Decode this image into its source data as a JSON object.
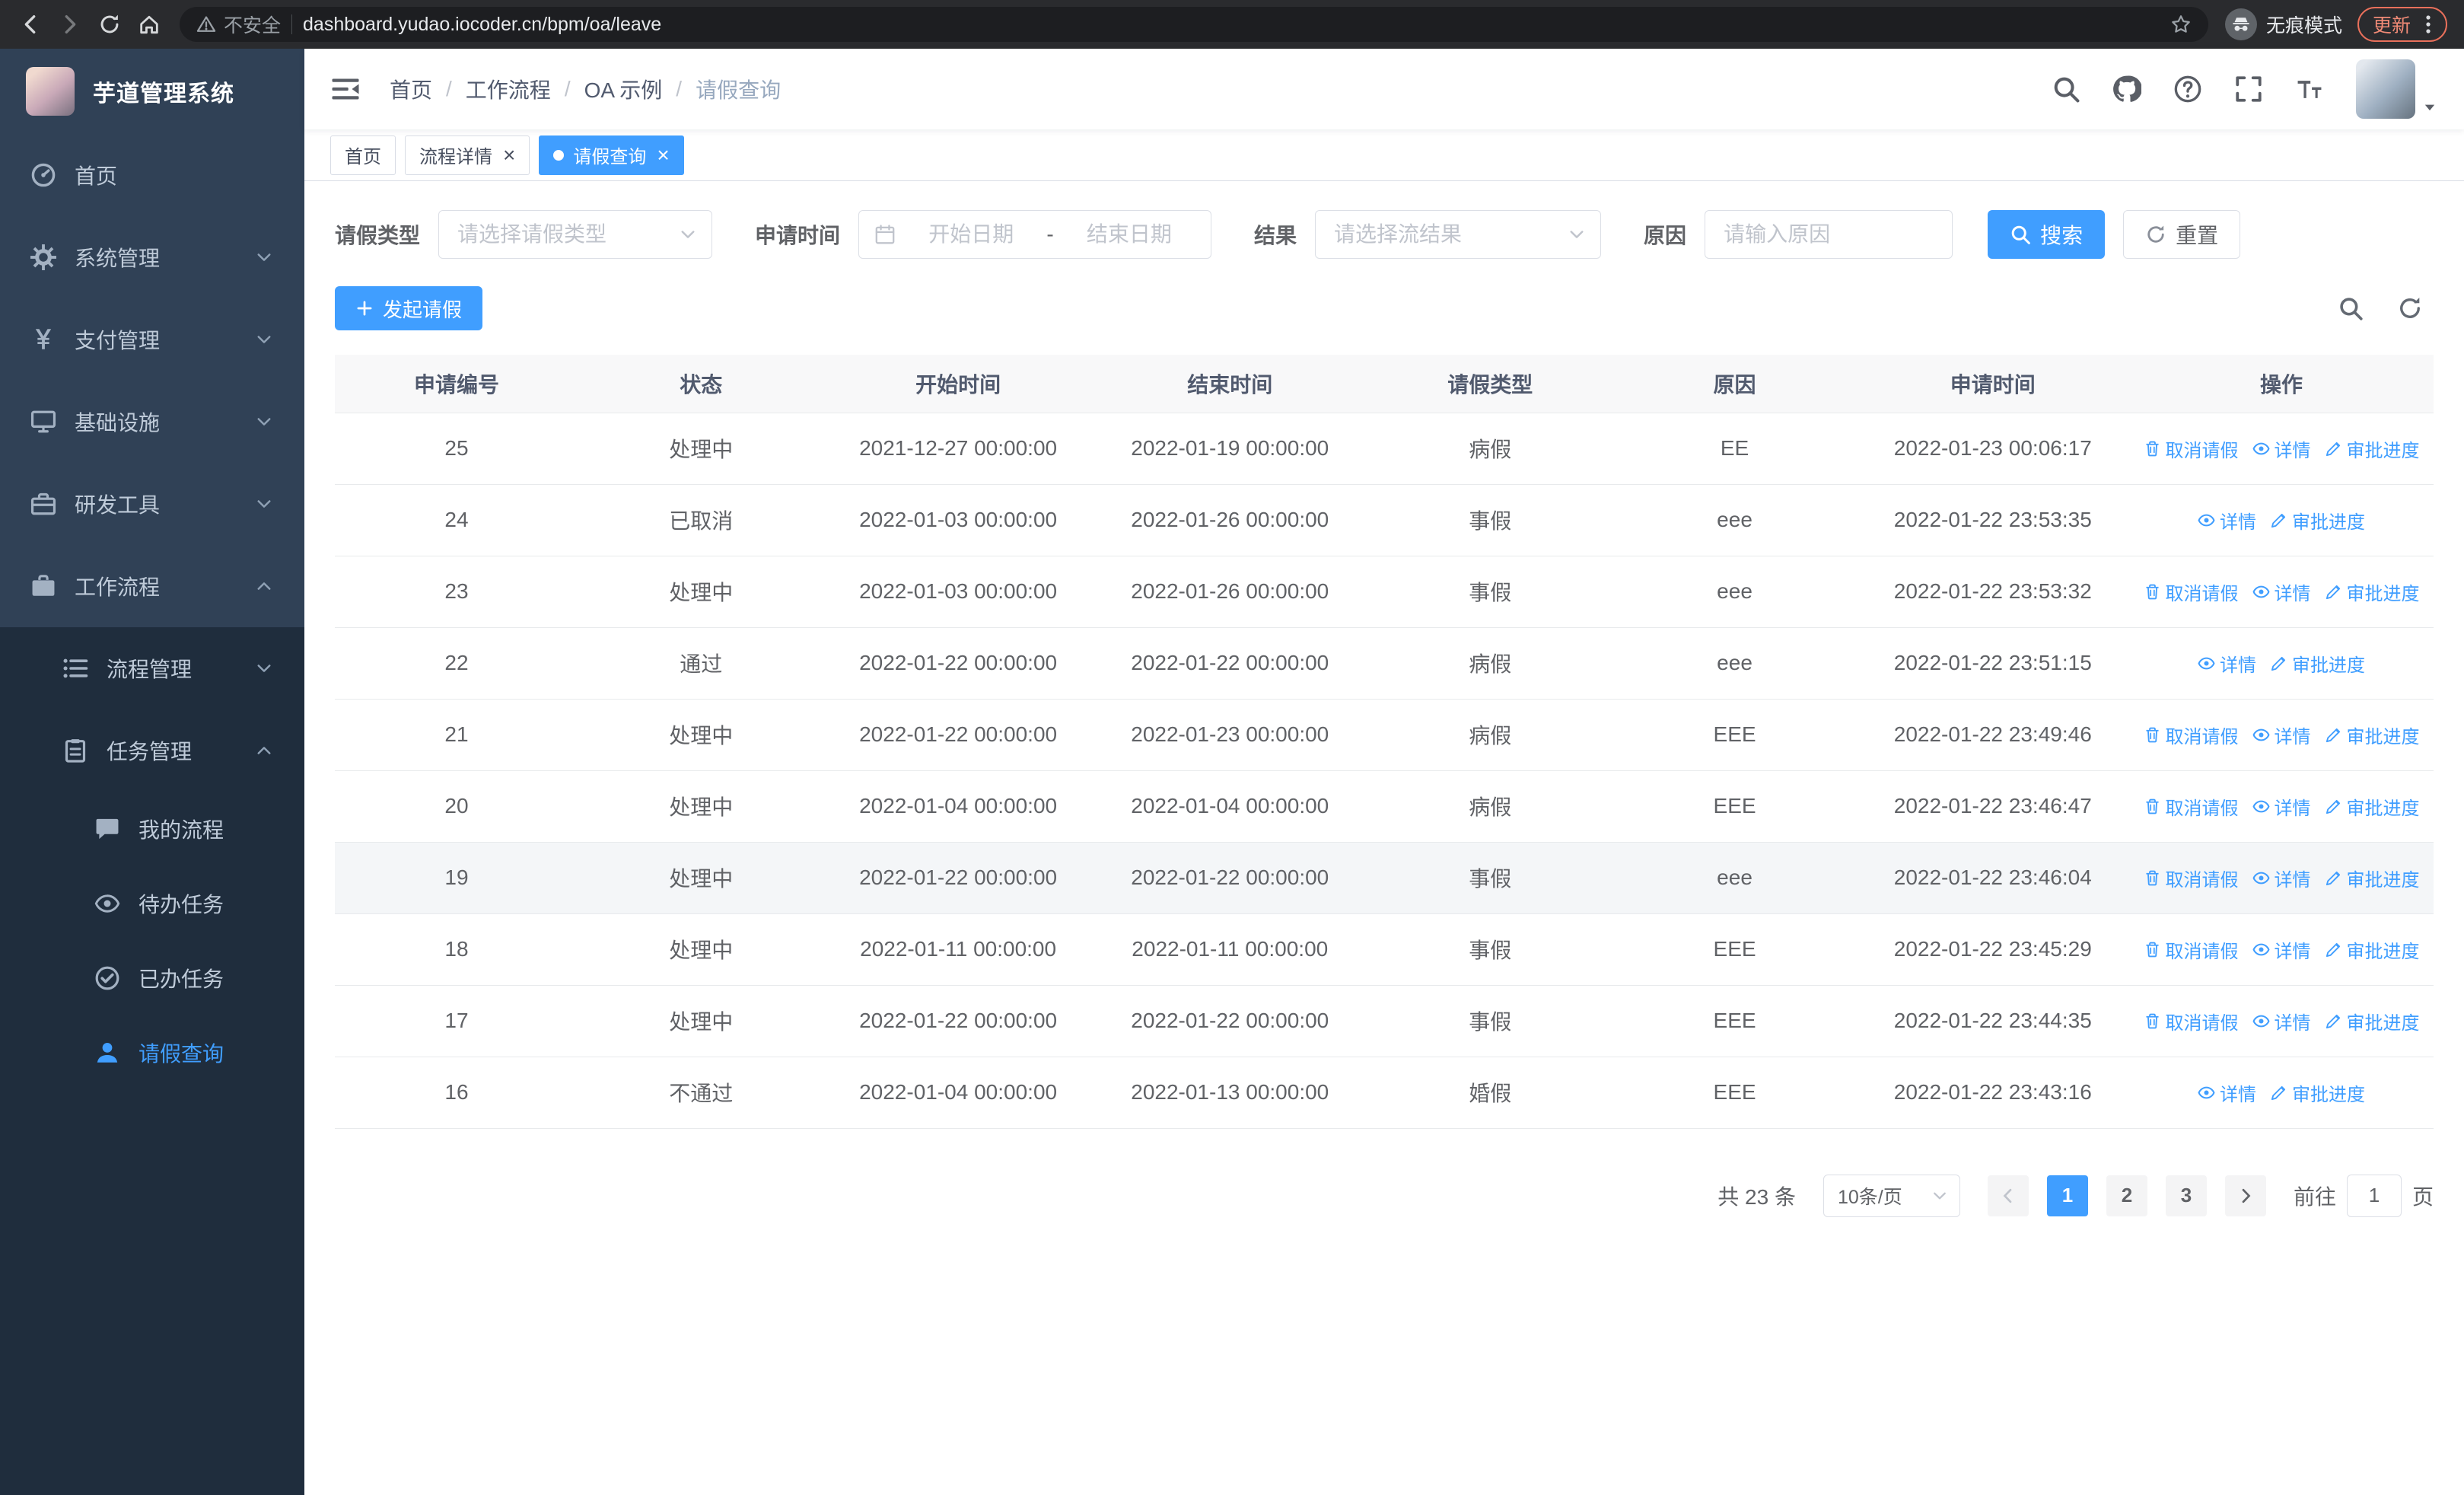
{
  "browser": {
    "security_text": "不安全",
    "url": "dashboard.yudao.iocoder.cn/bpm/oa/leave",
    "incognito_label": "无痕模式",
    "update_label": "更新"
  },
  "sidebar": {
    "title": "芋道管理系统",
    "menu": [
      {
        "key": "home",
        "label": "首页",
        "icon": "dashboard-icon",
        "level": 1
      },
      {
        "key": "system",
        "label": "系统管理",
        "icon": "gear-icon",
        "level": 1,
        "chevron": "down"
      },
      {
        "key": "payment",
        "label": "支付管理",
        "icon": "yen-icon",
        "level": 1,
        "chevron": "down"
      },
      {
        "key": "infra",
        "label": "基础设施",
        "icon": "monitor-icon",
        "level": 1,
        "chevron": "down"
      },
      {
        "key": "devtools",
        "label": "研发工具",
        "icon": "toolbox-icon",
        "level": 1,
        "chevron": "down"
      },
      {
        "key": "workflow",
        "label": "工作流程",
        "icon": "briefcase-icon",
        "level": 1,
        "chevron": "up"
      },
      {
        "key": "process-mgmt",
        "label": "流程管理",
        "icon": "list-icon",
        "level": 2,
        "chevron": "down"
      },
      {
        "key": "task-mgmt",
        "label": "任务管理",
        "icon": "tasks-icon",
        "level": 2,
        "chevron": "up"
      },
      {
        "key": "my-process",
        "label": "我的流程",
        "icon": "chat-icon",
        "level": 3
      },
      {
        "key": "todo-tasks",
        "label": "待办任务",
        "icon": "eye-icon",
        "level": 3
      },
      {
        "key": "done-tasks",
        "label": "已办任务",
        "icon": "check-icon",
        "level": 3
      },
      {
        "key": "leave-query",
        "label": "请假查询",
        "icon": "user-icon",
        "level": 3,
        "active": true
      }
    ]
  },
  "header": {
    "breadcrumb": [
      "首页",
      "工作流程",
      "OA 示例",
      "请假查询"
    ],
    "breadcrumb_sep": "/"
  },
  "tabs": [
    {
      "key": "home",
      "label": "首页",
      "closable": false,
      "active": false
    },
    {
      "key": "process-detail",
      "label": "流程详情",
      "closable": true,
      "active": false
    },
    {
      "key": "leave-query",
      "label": "请假查询",
      "closable": true,
      "active": true
    }
  ],
  "filters": {
    "leave_type": {
      "label": "请假类型",
      "placeholder": "请选择请假类型"
    },
    "apply_time": {
      "label": "申请时间",
      "start_placeholder": "开始日期",
      "separator": "-",
      "end_placeholder": "结束日期"
    },
    "result": {
      "label": "结果",
      "placeholder": "请选择流结果"
    },
    "reason": {
      "label": "原因",
      "placeholder": "请输入原因"
    },
    "search_label": "搜索",
    "reset_label": "重置"
  },
  "toolbar": {
    "create_label": "发起请假"
  },
  "table": {
    "columns": [
      "申请编号",
      "状态",
      "开始时间",
      "结束时间",
      "请假类型",
      "原因",
      "申请时间",
      "操作"
    ],
    "rows": [
      {
        "id": "25",
        "status": "处理中",
        "start": "2021-12-27 00:00:00",
        "end": "2022-01-19 00:00:00",
        "type": "病假",
        "reason": "EE",
        "applied": "2022-01-23 00:06:17",
        "actions": [
          {
            "name": "cancel-leave",
            "label": "取消请假",
            "icon": "delete-icon"
          },
          {
            "name": "detail",
            "label": "详情",
            "icon": "view-icon"
          },
          {
            "name": "approval-progress",
            "label": "审批进度",
            "icon": "edit-icon"
          }
        ]
      },
      {
        "id": "24",
        "status": "已取消",
        "start": "2022-01-03 00:00:00",
        "end": "2022-01-26 00:00:00",
        "type": "事假",
        "reason": "eee",
        "applied": "2022-01-22 23:53:35",
        "actions": [
          {
            "name": "detail",
            "label": "详情",
            "icon": "view-icon"
          },
          {
            "name": "approval-progress",
            "label": "审批进度",
            "icon": "edit-icon"
          }
        ]
      },
      {
        "id": "23",
        "status": "处理中",
        "start": "2022-01-03 00:00:00",
        "end": "2022-01-26 00:00:00",
        "type": "事假",
        "reason": "eee",
        "applied": "2022-01-22 23:53:32",
        "actions": [
          {
            "name": "cancel-leave",
            "label": "取消请假",
            "icon": "delete-icon"
          },
          {
            "name": "detail",
            "label": "详情",
            "icon": "view-icon"
          },
          {
            "name": "approval-progress",
            "label": "审批进度",
            "icon": "edit-icon"
          }
        ]
      },
      {
        "id": "22",
        "status": "通过",
        "start": "2022-01-22 00:00:00",
        "end": "2022-01-22 00:00:00",
        "type": "病假",
        "reason": "eee",
        "applied": "2022-01-22 23:51:15",
        "actions": [
          {
            "name": "detail",
            "label": "详情",
            "icon": "view-icon"
          },
          {
            "name": "approval-progress",
            "label": "审批进度",
            "icon": "edit-icon"
          }
        ]
      },
      {
        "id": "21",
        "status": "处理中",
        "start": "2022-01-22 00:00:00",
        "end": "2022-01-23 00:00:00",
        "type": "病假",
        "reason": "EEE",
        "applied": "2022-01-22 23:49:46",
        "actions": [
          {
            "name": "cancel-leave",
            "label": "取消请假",
            "icon": "delete-icon"
          },
          {
            "name": "detail",
            "label": "详情",
            "icon": "view-icon"
          },
          {
            "name": "approval-progress",
            "label": "审批进度",
            "icon": "edit-icon"
          }
        ]
      },
      {
        "id": "20",
        "status": "处理中",
        "start": "2022-01-04 00:00:00",
        "end": "2022-01-04 00:00:00",
        "type": "病假",
        "reason": "EEE",
        "applied": "2022-01-22 23:46:47",
        "actions": [
          {
            "name": "cancel-leave",
            "label": "取消请假",
            "icon": "delete-icon"
          },
          {
            "name": "detail",
            "label": "详情",
            "icon": "view-icon"
          },
          {
            "name": "approval-progress",
            "label": "审批进度",
            "icon": "edit-icon"
          }
        ]
      },
      {
        "id": "19",
        "status": "处理中",
        "start": "2022-01-22 00:00:00",
        "end": "2022-01-22 00:00:00",
        "type": "事假",
        "reason": "eee",
        "applied": "2022-01-22 23:46:04",
        "highlight": true,
        "actions": [
          {
            "name": "cancel-leave",
            "label": "取消请假",
            "icon": "delete-icon"
          },
          {
            "name": "detail",
            "label": "详情",
            "icon": "view-icon"
          },
          {
            "name": "approval-progress",
            "label": "审批进度",
            "icon": "edit-icon"
          }
        ]
      },
      {
        "id": "18",
        "status": "处理中",
        "start": "2022-01-11 00:00:00",
        "end": "2022-01-11 00:00:00",
        "type": "事假",
        "reason": "EEE",
        "applied": "2022-01-22 23:45:29",
        "actions": [
          {
            "name": "cancel-leave",
            "label": "取消请假",
            "icon": "delete-icon"
          },
          {
            "name": "detail",
            "label": "详情",
            "icon": "view-icon"
          },
          {
            "name": "approval-progress",
            "label": "审批进度",
            "icon": "edit-icon"
          }
        ]
      },
      {
        "id": "17",
        "status": "处理中",
        "start": "2022-01-22 00:00:00",
        "end": "2022-01-22 00:00:00",
        "type": "事假",
        "reason": "EEE",
        "applied": "2022-01-22 23:44:35",
        "actions": [
          {
            "name": "cancel-leave",
            "label": "取消请假",
            "icon": "delete-icon"
          },
          {
            "name": "detail",
            "label": "详情",
            "icon": "view-icon"
          },
          {
            "name": "approval-progress",
            "label": "审批进度",
            "icon": "edit-icon"
          }
        ]
      },
      {
        "id": "16",
        "status": "不通过",
        "start": "2022-01-04 00:00:00",
        "end": "2022-01-13 00:00:00",
        "type": "婚假",
        "reason": "EEE",
        "applied": "2022-01-22 23:43:16",
        "actions": [
          {
            "name": "detail",
            "label": "详情",
            "icon": "view-icon"
          },
          {
            "name": "approval-progress",
            "label": "审批进度",
            "icon": "edit-icon"
          }
        ]
      }
    ]
  },
  "pagination": {
    "total_text": "共 23 条",
    "page_size_text": "10条/页",
    "pages": [
      "1",
      "2",
      "3"
    ],
    "active_page": "1",
    "goto_prefix": "前往",
    "goto_value": "1",
    "goto_suffix": "页"
  },
  "colors": {
    "primary": "#409eff",
    "sidebar_bg": "#304156",
    "submenu_bg": "#1f2d3d"
  }
}
